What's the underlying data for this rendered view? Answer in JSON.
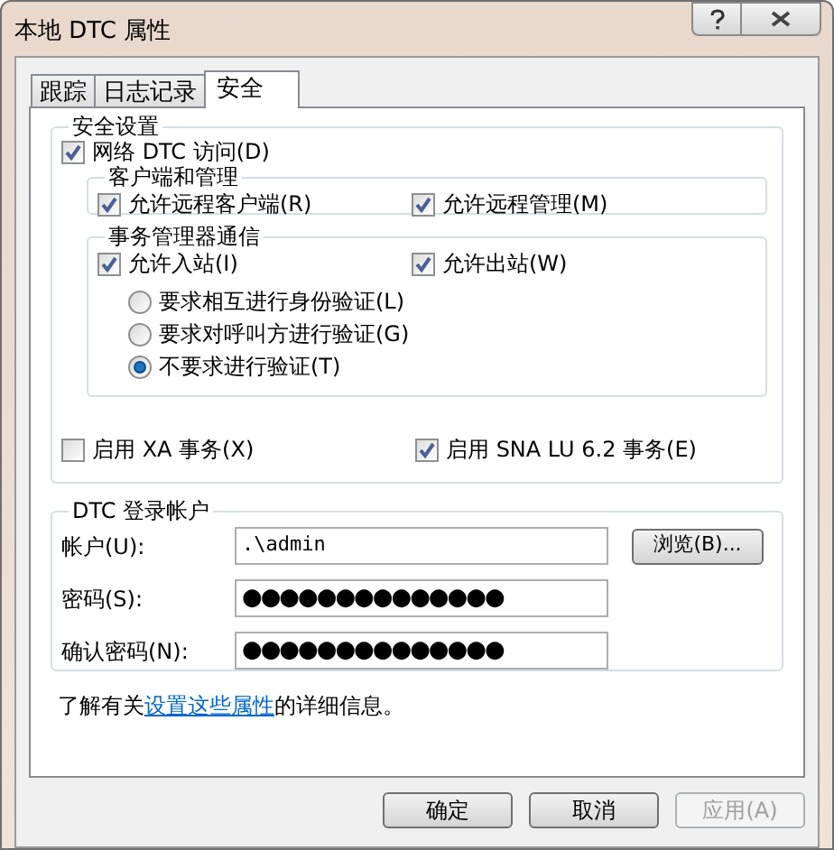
{
  "window": {
    "title": "本地 DTC 属性"
  },
  "tabs": [
    {
      "label": "跟踪",
      "selected": false
    },
    {
      "label": "日志记录",
      "selected": false
    },
    {
      "label": "安全",
      "selected": true
    }
  ],
  "security_settings": {
    "title": "安全设置",
    "network_access": {
      "label": "网络 DTC 访问(D)",
      "checked": true
    },
    "client_admin": {
      "title": "客户端和管理",
      "items": [
        {
          "label": "允许远程客户端(R)",
          "checked": true
        },
        {
          "label": "允许远程管理(M)",
          "checked": true
        }
      ]
    },
    "tm_communication": {
      "title": "事务管理器通信",
      "items": [
        {
          "label": "允许入站(I)",
          "checked": true
        },
        {
          "label": "允许出站(W)",
          "checked": true
        }
      ],
      "authentication": [
        {
          "label": "要求相互进行身份验证(L)",
          "selected": false
        },
        {
          "label": "要求对呼叫方进行验证(G)",
          "selected": false
        },
        {
          "label": "不要求进行验证(T)",
          "selected": true
        }
      ]
    },
    "transactions": [
      {
        "label": "启用 XA 事务(X)",
        "checked": false
      },
      {
        "label": "启用 SNA LU 6.2 事务(E)",
        "checked": true
      }
    ]
  },
  "logon_account": {
    "title": "DTC 登录帐户",
    "fields": [
      {
        "kind": "text",
        "label": "帐户(U):",
        "value": ".\\admin"
      },
      {
        "kind": "password",
        "label": "密码(S):",
        "value": "●●●●●●●●●●●●●●"
      },
      {
        "kind": "password",
        "label": "确认密码(N):",
        "value": "●●●●●●●●●●●●●●"
      }
    ],
    "browse_button": "浏览(B)..."
  },
  "info": {
    "prefix": "了解有关",
    "link": "设置这些属性",
    "suffix": "的详细信息。"
  },
  "buttons": [
    {
      "label": "确定",
      "disabled": false
    },
    {
      "label": "取消",
      "disabled": false
    },
    {
      "label": "应用(A)",
      "disabled": true
    }
  ]
}
